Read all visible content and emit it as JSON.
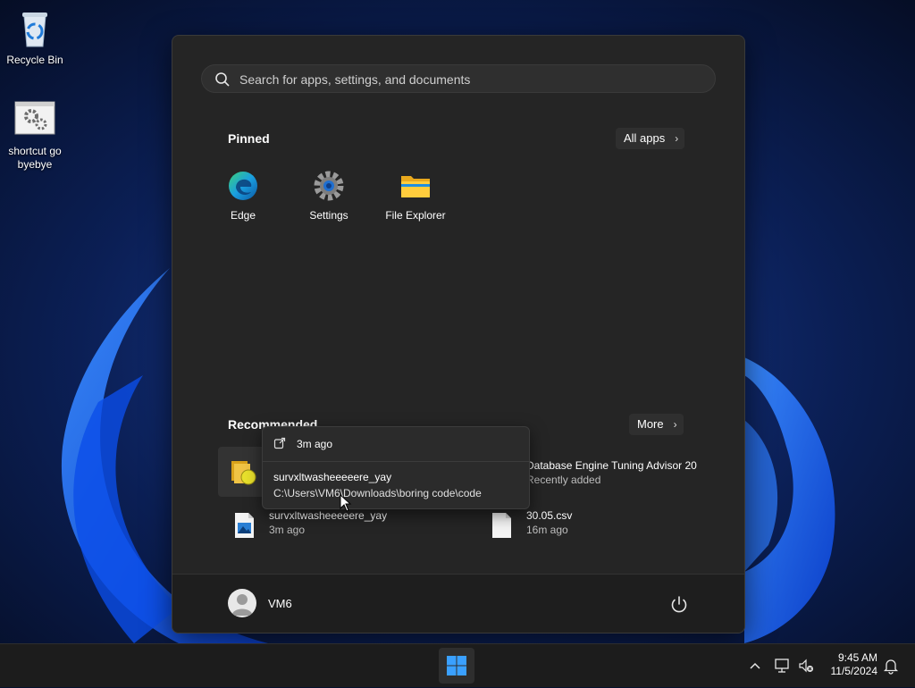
{
  "desktop": {
    "icons": [
      {
        "label": "Recycle Bin",
        "icon": "recycle-bin-icon"
      },
      {
        "label": "shortcut go byebye",
        "icon": "shortcut-gear-icon"
      }
    ]
  },
  "start_menu": {
    "search": {
      "placeholder": "Search for apps, settings, and documents"
    },
    "pinned": {
      "title": "Pinned",
      "all_apps_label": "All apps",
      "apps": [
        {
          "label": "Edge",
          "icon": "edge-icon"
        },
        {
          "label": "Settings",
          "icon": "settings-gear-icon"
        },
        {
          "label": "File Explorer",
          "icon": "folder-icon"
        }
      ]
    },
    "recommended": {
      "title": "Recommended",
      "more_label": "More",
      "items": [
        {
          "name": "",
          "sub": "",
          "icon": "package-folder-icon"
        },
        {
          "name": "Database Engine Tuning Advisor 20",
          "sub": "Recently added",
          "icon": "database-tool-icon"
        },
        {
          "name": "survxltwasheeeeere_yay",
          "sub": "3m ago",
          "icon": "image-file-icon"
        },
        {
          "name": "30.05.csv",
          "sub": "16m ago",
          "icon": "csv-file-icon"
        }
      ]
    },
    "tooltip": {
      "time": "3m ago",
      "name": "survxltwasheeeeere_yay",
      "path": "C:\\Users\\VM6\\Downloads\\boring code\\code"
    },
    "user": {
      "name": "VM6"
    }
  },
  "taskbar": {
    "clock": {
      "time": "9:45 AM",
      "date": "11/5/2024"
    }
  },
  "colors": {
    "accent": "#0f6cbd",
    "menu_bg": "#252525",
    "taskbar_bg": "#1c1c1c"
  }
}
